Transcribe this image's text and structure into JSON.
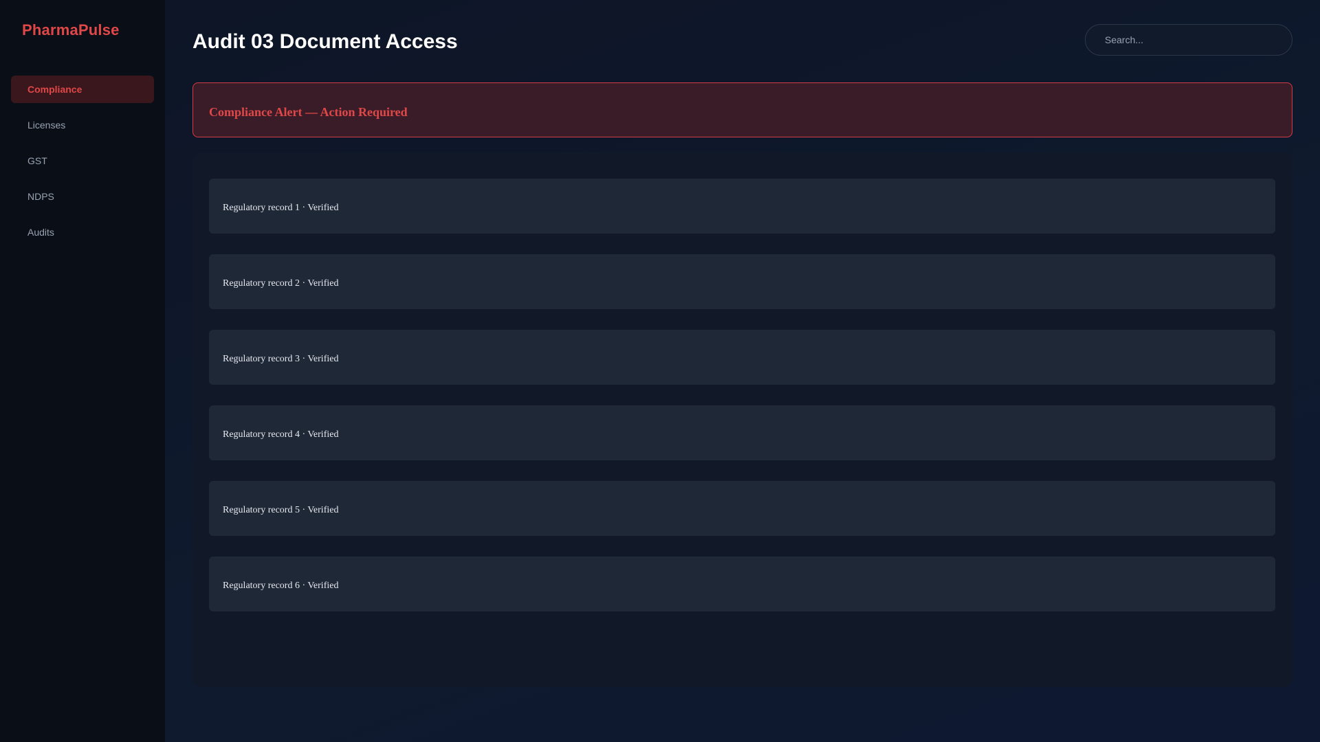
{
  "sidebar": {
    "brand": "PharmaPulse",
    "items": [
      {
        "label": "Compliance",
        "active": true
      },
      {
        "label": "Licenses",
        "active": false
      },
      {
        "label": "GST",
        "active": false
      },
      {
        "label": "NDPS",
        "active": false
      },
      {
        "label": "Audits",
        "active": false
      }
    ]
  },
  "header": {
    "title": "Audit 03 Document Access",
    "search_placeholder": "Search..."
  },
  "alert": {
    "text": "Compliance Alert — Action Required"
  },
  "records": [
    {
      "label": "Regulatory record 1 · Verified"
    },
    {
      "label": "Regulatory record 2 · Verified"
    },
    {
      "label": "Regulatory record 3 · Verified"
    },
    {
      "label": "Regulatory record 4 · Verified"
    },
    {
      "label": "Regulatory record 5 · Verified"
    },
    {
      "label": "Regulatory record 6 · Verified"
    }
  ],
  "colors": {
    "accent": "#e04848",
    "sidebar_bg": "#0a0e17",
    "main_bg": "#0d1526",
    "alert_bg": "#3a1c29",
    "record_bg": "#1f2837"
  }
}
